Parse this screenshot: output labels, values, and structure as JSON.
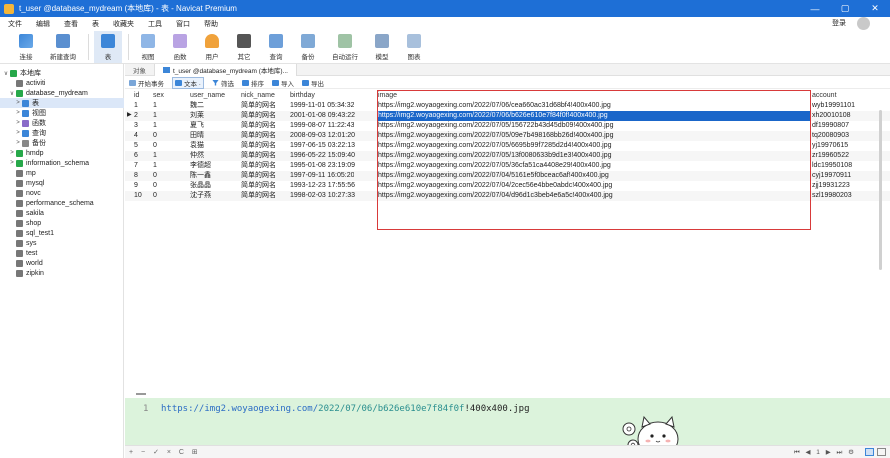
{
  "window": {
    "title": "t_user @database_mydream (本地库) - 表 - Navicat Premium",
    "controls": [
      "—",
      "▢",
      "✕"
    ]
  },
  "menu": {
    "items": [
      "文件",
      "编辑",
      "查看",
      "表",
      "收藏夹",
      "工具",
      "窗口",
      "帮助"
    ],
    "login_label": "登录"
  },
  "toolbar": {
    "buttons": [
      {
        "label": "连接",
        "icon": "connect-icon"
      },
      {
        "label": "新建查询",
        "icon": "new-query-icon"
      },
      {
        "label": "表",
        "icon": "table-icon"
      },
      {
        "label": "视图",
        "icon": "view-icon"
      },
      {
        "label": "函数",
        "icon": "function-icon"
      },
      {
        "label": "用户",
        "icon": "user-icon"
      },
      {
        "label": "其它",
        "icon": "other-icon"
      },
      {
        "label": "查询",
        "icon": "query-icon"
      },
      {
        "label": "备份",
        "icon": "backup-icon"
      },
      {
        "label": "自动运行",
        "icon": "auto-run-icon"
      },
      {
        "label": "模型",
        "icon": "model-icon"
      },
      {
        "label": "图表",
        "icon": "chart-icon"
      }
    ]
  },
  "sidebar": {
    "items": [
      {
        "label": "本地库",
        "level": 0,
        "arrow": "∨",
        "color": "#27a84a"
      },
      {
        "label": "activiti",
        "level": 1,
        "arrow": "",
        "color": "#777777"
      },
      {
        "label": "database_mydream",
        "level": 1,
        "arrow": "∨",
        "color": "#27a84a"
      },
      {
        "label": "表",
        "level": 2,
        "arrow": ">",
        "color": "#3c86d8",
        "selected": true
      },
      {
        "label": "视图",
        "level": 2,
        "arrow": ">",
        "color": "#3c86d8"
      },
      {
        "label": "函数",
        "level": 2,
        "arrow": ">",
        "color": "#8a6bc9"
      },
      {
        "label": "查询",
        "level": 2,
        "arrow": ">",
        "color": "#3c86d8"
      },
      {
        "label": "备份",
        "level": 2,
        "arrow": ">",
        "color": "#888888"
      },
      {
        "label": "hmdp",
        "level": 1,
        "arrow": ">",
        "color": "#27a84a"
      },
      {
        "label": "information_schema",
        "level": 1,
        "arrow": ">",
        "color": "#27a84a"
      },
      {
        "label": "mp",
        "level": 1,
        "arrow": "",
        "color": "#777777"
      },
      {
        "label": "mysql",
        "level": 1,
        "arrow": "",
        "color": "#777777"
      },
      {
        "label": "novc",
        "level": 1,
        "arrow": "",
        "color": "#777777"
      },
      {
        "label": "performance_schema",
        "level": 1,
        "arrow": "",
        "color": "#777777"
      },
      {
        "label": "sakila",
        "level": 1,
        "arrow": "",
        "color": "#777777"
      },
      {
        "label": "shop",
        "level": 1,
        "arrow": "",
        "color": "#777777"
      },
      {
        "label": "sql_test1",
        "level": 1,
        "arrow": "",
        "color": "#777777"
      },
      {
        "label": "sys",
        "level": 1,
        "arrow": "",
        "color": "#777777"
      },
      {
        "label": "test",
        "level": 1,
        "arrow": "",
        "color": "#777777"
      },
      {
        "label": "world",
        "level": 1,
        "arrow": "",
        "color": "#777777"
      },
      {
        "label": "zipkin",
        "level": 1,
        "arrow": "",
        "color": "#777777"
      }
    ]
  },
  "tabs": {
    "objects_label": "对象",
    "active_label": "t_user @database_mydream (本地库)..."
  },
  "grid_toolbar": {
    "begin_tx": "开始事务",
    "text": "文本 ·",
    "filter": "筛选",
    "sort": "排序",
    "import": "导入",
    "export": "导出"
  },
  "table": {
    "columns": [
      "id",
      "sex",
      "user_name",
      "nick_name",
      "birthday",
      "image",
      "account"
    ],
    "rows": [
      [
        "1",
        "1",
        "魏二",
        "简单的网名",
        "1999-11-01 05:34:32",
        "https://img2.woyaogexing.com/2022/07/06/cea660ac31d68bf4!400x400.jpg",
        "wyb19991101"
      ],
      [
        "2",
        "1",
        "刘莱",
        "简单的网名",
        "2001-01-08 09:43:22",
        "https://img2.woyaogexing.com/2022/07/06/b626e610e7f84f0f!400x400.jpg",
        "xh20010108"
      ],
      [
        "3",
        "1",
        "夏飞",
        "简单的网名",
        "1999-08-07 11:22:43",
        "https://img2.woyaogexing.com/2022/07/05/156722b43d45db09!400x400.jpg",
        "df19990807"
      ],
      [
        "4",
        "0",
        "田晴",
        "简单的网名",
        "2008-09-03 12:01:20",
        "https://img2.woyaogexing.com/2022/07/05/09e7b498168bb26d!400x400.jpg",
        "tq20080903"
      ],
      [
        "5",
        "0",
        "袁猫",
        "简单的网名",
        "1997-06-15 03:22:13",
        "https://img2.woyaogexing.com/2022/07/05/6695b99f7285d2d4!400x400.jpg",
        "yj19970615"
      ],
      [
        "6",
        "1",
        "仲然",
        "简单的网名",
        "1996-05-22 15:09:40",
        "https://img2.woyaogexing.com/2022/07/05/13f0080633b9d1e3!400x400.jpg",
        "zr19960522"
      ],
      [
        "7",
        "1",
        "李德超",
        "简单的网名",
        "1995-01-08 23:19:09",
        "https://img2.woyaogexing.com/2022/07/05/36cfa51ca4408e29!400x400.jpg",
        "ldc19950108"
      ],
      [
        "8",
        "0",
        "陈一鑫",
        "简单的网名",
        "1997-09-11 16:05:20",
        "https://img2.woyaogexing.com/2022/07/04/5161e5f0bceac6af!400x400.jpg",
        "cyj19970911"
      ],
      [
        "9",
        "0",
        "张晶晶",
        "简单的网名",
        "1993-12-23 17:55:56",
        "https://img2.woyaogexing.com/2022/07/04/2cec56e4bbe0abdc!400x400.jpg",
        "zjj19931223"
      ],
      [
        "10",
        "0",
        "沈子燕",
        "简单的网名",
        "1998-02-03 10:27:33",
        "https://img2.woyaogexing.com/2022/07/04/d96d1c3beb4e6a5c!400x400.jpg",
        "szl19980203"
      ]
    ],
    "selected_row": 1,
    "row_marker": "▶"
  },
  "preview": {
    "line_number": "1",
    "url_scheme": "https://",
    "url_host": "img2.woyaogexing.com/",
    "url_path": "2022/07/06/b626e610e7f84f0f",
    "url_tail": "!400x400.jpg"
  },
  "statusbar": {
    "left_controls": "+ − ✓ × C ⊞",
    "pager": "⏮ ◀ 1 ▶ ⏭ ⚙"
  },
  "colors": {
    "titlebar": "#1e6fd6",
    "selection": "#1a66c9",
    "highlight_frame": "#d83a3a",
    "preview_bg": "#dcf3dc"
  }
}
